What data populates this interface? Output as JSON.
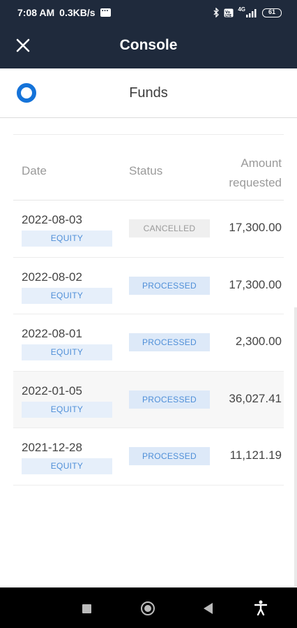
{
  "status_bar": {
    "time": "7:08 AM",
    "speed": "0.3KB/s",
    "network": "4G",
    "battery": "61"
  },
  "header": {
    "title": "Console",
    "close_icon": "close-icon"
  },
  "funds_bar": {
    "title": "Funds",
    "logo_icon": "brand-logo"
  },
  "table": {
    "headers": {
      "date": "Date",
      "status": "Status",
      "amount_line1": "Amount",
      "amount_line2": "requested"
    },
    "rows": [
      {
        "date": "2022-08-03",
        "segment": "EQUITY",
        "status": "CANCELLED",
        "amount": "17,300.00"
      },
      {
        "date": "2022-08-02",
        "segment": "EQUITY",
        "status": "PROCESSED",
        "amount": "17,300.00"
      },
      {
        "date": "2022-08-01",
        "segment": "EQUITY",
        "status": "PROCESSED",
        "amount": "2,300.00"
      },
      {
        "date": "2022-01-05",
        "segment": "EQUITY",
        "status": "PROCESSED",
        "amount": "36,027.41"
      },
      {
        "date": "2021-12-28",
        "segment": "EQUITY",
        "status": "PROCESSED",
        "amount": "11,121.19"
      }
    ]
  },
  "colors": {
    "header_bg": "#1f2a3c",
    "accent": "#1573d9",
    "tag_text": "#4f8fd8",
    "tag_bg": "#e6effa"
  }
}
